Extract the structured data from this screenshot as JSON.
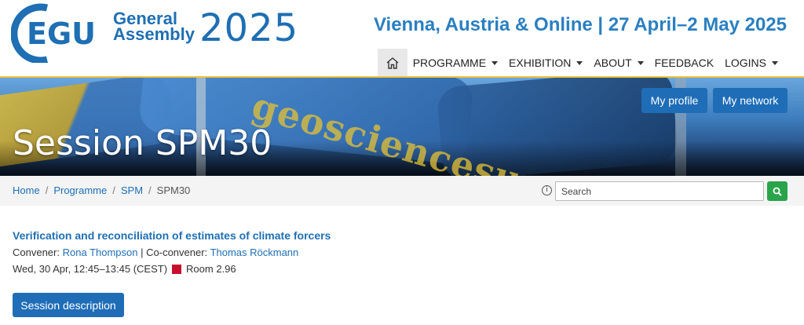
{
  "logo": {
    "mark_text": "EGU",
    "line1": "General",
    "line2": "Assembly",
    "year": "2025"
  },
  "tagline": "Vienna, Austria & Online | 27 April–2 May 2025",
  "nav": {
    "home_icon": "home-icon",
    "items": [
      {
        "label": "PROGRAMME",
        "dropdown": true
      },
      {
        "label": "EXHIBITION",
        "dropdown": true
      },
      {
        "label": "ABOUT",
        "dropdown": true
      },
      {
        "label": "FEEDBACK",
        "dropdown": false
      },
      {
        "label": "LOGINS",
        "dropdown": true
      }
    ]
  },
  "banner": {
    "title": "Session SPM30",
    "watermark": "geosciencesunion",
    "my_profile": "My profile",
    "my_network": "My network"
  },
  "breadcrumb": {
    "home": "Home",
    "programme": "Programme",
    "spm": "SPM",
    "current": "SPM30",
    "separator": "/"
  },
  "search": {
    "placeholder": "Search",
    "info_icon": "info-icon",
    "button_icon": "search-icon"
  },
  "session": {
    "title": "Verification and reconciliation of estimates of climate forcers",
    "convener_label": "Convener:",
    "convener": "Rona Thompson",
    "divider": "|",
    "co_convener_label": "Co-convener:",
    "co_convener": "Thomas Röckmann",
    "time": "Wed, 30 Apr, 12:45–13:45 (CEST)",
    "room": "Room 2.96",
    "description_button": "Session description"
  },
  "colors": {
    "brand_blue": "#1e6fb3",
    "button_blue": "#1f6db7",
    "search_green": "#2aa44a",
    "room_red": "#c8102e",
    "accent_yellow": "#f0c33c"
  }
}
